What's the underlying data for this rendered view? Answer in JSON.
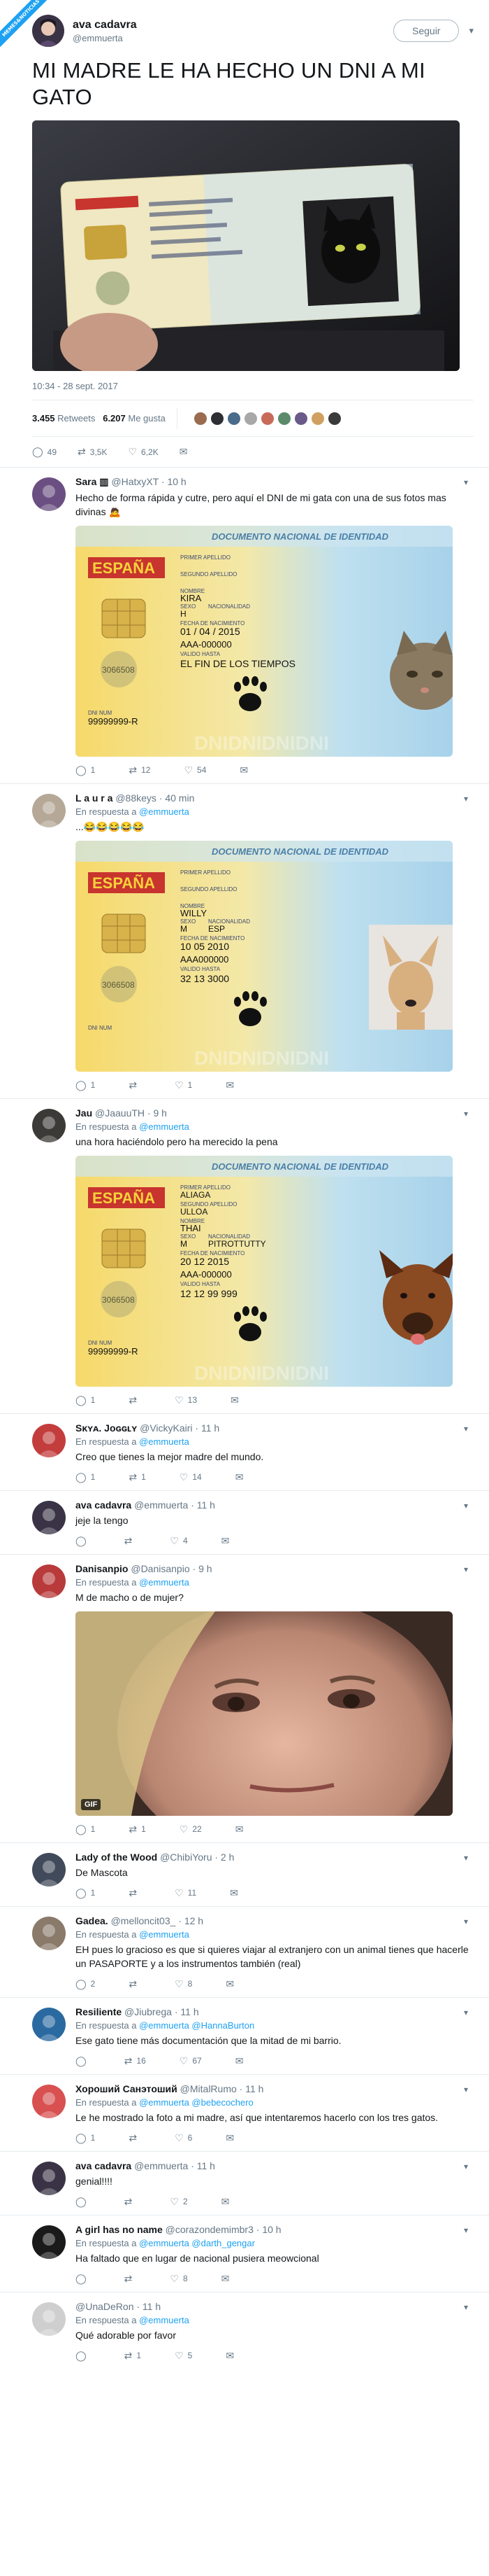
{
  "ribbon": "MEMES&NOTICIAS",
  "tweet": {
    "name": "ava cadavra",
    "handle": "@emmuerta",
    "follow_label": "Seguir",
    "text": "MI MADRE LE HA HECHO UN DNI A MI GATO",
    "timestamp": "10:34 - 28 sept. 2017",
    "retweets_count": "3.455",
    "retweets_label": "Retweets",
    "likes_count": "6.207",
    "likes_label": "Me gusta",
    "actions": {
      "replies": "49",
      "retweets": "3,5K",
      "likes": "6,2K"
    }
  },
  "card": {
    "header": "DOCUMENTO NACIONAL DE IDENTIDAD",
    "country": "ESPAÑA",
    "l_ap1": "PRIMER APELLIDO",
    "l_ap2": "SEGUNDO APELLIDO",
    "l_name": "NOMBRE",
    "l_sex": "SEXO",
    "l_nat": "NACIONALIDAD",
    "l_birth": "FECHA DE NACIMIENTO",
    "l_valid": "VALIDO HASTA",
    "l_dninum": "DNI NUM",
    "code": "3066508",
    "watermark": "DNIDNIDNIDNI"
  },
  "replies": [
    {
      "name": "Sara ▥",
      "handle": "@HatxyXT",
      "time": "· 10 h",
      "text": "Hecho de forma rápida y cutre, pero aquí el DNI de mi gata con una de sus fotos mas divinas 🙇",
      "card": {
        "ap1": "",
        "ap2": "",
        "name": "KIRA",
        "sex": "H",
        "nat": "",
        "birth": "01 / 04 / 2015",
        "num": "AAA-000000",
        "valid": "EL FIN DE LOS TIEMPOS",
        "dni": "99999999-R"
      },
      "actions": {
        "replies": "1",
        "retweets": "12",
        "likes": "54"
      }
    },
    {
      "name": "L a u r a",
      "handle": "@88keys",
      "time": "· 40 min",
      "in_reply_label": "En respuesta a",
      "in_reply_to": "@emmuerta",
      "text": "...😂😂😂😂😂",
      "card": {
        "ap1": "",
        "ap2": "",
        "name": "WILLY",
        "sex": "M",
        "nat": "ESP",
        "birth": "10 05 2010",
        "num": "AAA000000",
        "valid": "32 13 3000",
        "dni": ""
      },
      "actions": {
        "replies": "1",
        "retweets": "",
        "likes": "1"
      }
    },
    {
      "name": "Jau",
      "handle": "@JaauuTH",
      "time": "· 9 h",
      "in_reply_label": "En respuesta a",
      "in_reply_to": "@emmuerta",
      "text": "una hora haciéndolo pero ha merecido la pena",
      "card": {
        "ap1": "ALIAGA",
        "ap2": "ULLOA",
        "name": "THAI",
        "sex": "M",
        "nat": "PITROTTUTTY",
        "birth": "20   12   2015",
        "num": "AAA-000000",
        "valid": "12   12   99 999",
        "dni": "99999999-R"
      },
      "actions": {
        "replies": "1",
        "retweets": "",
        "likes": "13"
      }
    },
    {
      "name": "Sᴋʏᴀ. Jᴏɢɢʟʏ",
      "handle": "@VickyKairi",
      "time": "· 11 h",
      "in_reply_label": "En respuesta a",
      "in_reply_to": "@emmuerta",
      "text": "Creo que tienes la mejor madre del mundo.",
      "actions": {
        "replies": "1",
        "retweets": "1",
        "likes": "14"
      }
    },
    {
      "name": "ava cadavra",
      "handle": "@emmuerta",
      "time": "· 11 h",
      "text": "jeje la tengo",
      "actions": {
        "replies": "",
        "retweets": "",
        "likes": "4"
      }
    },
    {
      "name": "Danisanpio",
      "handle": "@Danisanpio",
      "time": "· 9 h",
      "in_reply_label": "En respuesta a",
      "in_reply_to": "@emmuerta",
      "text": "M de macho o de mujer?",
      "gif_label": "GIF",
      "actions": {
        "replies": "1",
        "retweets": "1",
        "likes": "22"
      }
    },
    {
      "name": "Lady of the Wood",
      "handle": "@ChibiYoru",
      "time": "· 2 h",
      "text": "De Mascota",
      "actions": {
        "replies": "1",
        "retweets": "",
        "likes": "11"
      }
    },
    {
      "name": "Gadea.",
      "handle": "@melloncit03_",
      "time": "· 12 h",
      "in_reply_label": "En respuesta a",
      "in_reply_to": "@emmuerta",
      "text": "EH pues lo gracioso es que si quieres viajar al extranjero con un animal tienes que hacerle un PASAPORTE y a los instrumentos también (real)",
      "actions": {
        "replies": "2",
        "retweets": "",
        "likes": "8"
      }
    },
    {
      "name": "Resiliente",
      "handle": "@Jiubrega",
      "time": "· 11 h",
      "in_reply_label": "En respuesta a",
      "in_reply_to": "@emmuerta @HannaBurton",
      "text": "Ese gato tiene más documentación que la mitad de mi barrio.",
      "actions": {
        "replies": "",
        "retweets": "16",
        "likes": "67"
      }
    },
    {
      "name": "Хороший Санэтоший",
      "handle": "@MitalRumo",
      "time": "· 11 h",
      "in_reply_label": "En respuesta a",
      "in_reply_to": "@emmuerta @bebecochero",
      "text": "Le he mostrado la foto a mi madre, así que intentaremos hacerlo con los tres gatos.",
      "actions": {
        "replies": "1",
        "retweets": "",
        "likes": "6"
      }
    },
    {
      "name": "ava cadavra",
      "handle": "@emmuerta",
      "time": "· 11 h",
      "text": "genial!!!!",
      "actions": {
        "replies": "",
        "retweets": "",
        "likes": "2"
      }
    },
    {
      "name": "A girl has no name",
      "handle": "@corazondemimbr3",
      "time": "· 10 h",
      "in_reply_label": "En respuesta a",
      "in_reply_to": "@emmuerta @darth_gengar",
      "text": "Ha faltado que en lugar de nacional pusiera meowcional",
      "actions": {
        "replies": "",
        "retweets": "",
        "likes": "8"
      }
    },
    {
      "name": "",
      "handle": "@UnaDeRon",
      "time": "· 11 h",
      "in_reply_label": "En respuesta a",
      "in_reply_to": "@emmuerta",
      "text": "Qué adorable por favor",
      "actions": {
        "replies": "",
        "retweets": "1",
        "likes": "5"
      }
    }
  ]
}
